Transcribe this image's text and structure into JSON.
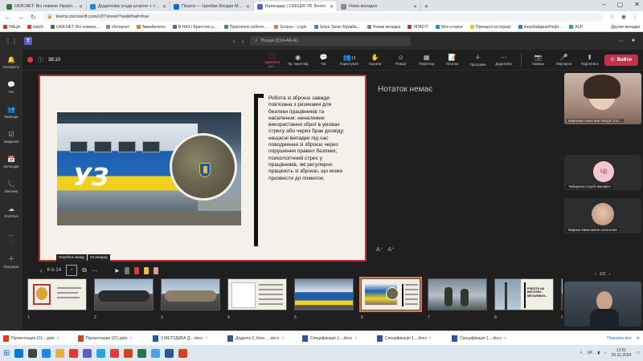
{
  "browser": {
    "tabs": [
      {
        "label": "UKR.NET: Всі новини України, о",
        "color": "#2f7d32"
      },
      {
        "label": "Додаткова угода штатне + трен",
        "color": "#1e88e5"
      },
      {
        "label": "Пошта — Цюхбах Богдан Микол",
        "color": "#0f6cbd"
      },
      {
        "label": "Календар | СЕКЦІЯ УБ Зонсп",
        "color": "#5b5fc7",
        "active": true
      },
      {
        "label": "Нова вкладка",
        "color": "#888888"
      }
    ],
    "url": "teams.microsoft.com/v2/?show#?walkthalt=true",
    "bookmarks": [
      {
        "label": "НАЦА",
        "color": "#c0392b"
      },
      {
        "label": "watch",
        "color": "#e53935"
      },
      {
        "label": "UKR.NET: Всі новини...",
        "color": "#2f7d32"
      },
      {
        "label": "Интернет",
        "color": "#888"
      },
      {
        "label": "Авиабилеты",
        "color": "#e67e22"
      },
      {
        "label": "В НАЗ | Братство р...",
        "color": "#8e44ad"
      },
      {
        "label": "Практичне роботе...",
        "color": "#16a085"
      },
      {
        "label": "Scopus - Login",
        "color": "#e67e22"
      },
      {
        "label": "Setye Загин Брумба...",
        "color": "#1e88e5"
      },
      {
        "label": "Новая вкладка",
        "color": "#888"
      },
      {
        "label": "НПАСІТ",
        "color": "#c0392b"
      },
      {
        "label": "Моя сторінг",
        "color": "#1e88e5"
      },
      {
        "label": "Прихарні інструкції",
        "color": "#f1c40f"
      },
      {
        "label": "АзербайджанНефт...",
        "color": "#2980b9"
      },
      {
        "label": "АСР",
        "color": "#27ae60"
      }
    ],
    "bookmarks_more": "Другие вкладки"
  },
  "teams": {
    "search_placeholder": "Пошук (Ctrl+Alt+E)",
    "rail": [
      {
        "label": "Активність",
        "icon": "bell-icon",
        "glyph": "🔔"
      },
      {
        "label": "Чат",
        "icon": "chat-icon",
        "glyph": "💬"
      },
      {
        "label": "Команди",
        "icon": "teams-icon",
        "glyph": "👥"
      },
      {
        "label": "Завдання",
        "icon": "tasks-icon",
        "glyph": "☑"
      },
      {
        "label": "Календар",
        "icon": "calendar-icon",
        "glyph": "📅"
      },
      {
        "label": "Виклики",
        "icon": "calls-icon",
        "glyph": "📞"
      },
      {
        "label": "OneDrive",
        "icon": "cloud-icon",
        "glyph": "☁"
      },
      {
        "label": "...",
        "icon": "more-icon",
        "glyph": "…"
      },
      {
        "label": "Програми",
        "icon": "apps-icon",
        "glyph": "＋"
      }
    ],
    "meeting": {
      "timer": "38:10",
      "tools": [
        {
          "label": "Закінчити дос...",
          "glyph": "⬚",
          "name": "stop-sharing-icon",
          "red": true
        },
        {
          "label": "Пр. перегляд",
          "glyph": "◉",
          "name": "preview-icon"
        },
        {
          "label": "Чат",
          "glyph": "💬",
          "name": "meeting-chat-icon"
        },
        {
          "label": "Користувачі",
          "glyph": "👥",
          "name": "people-icon",
          "badge": "13"
        },
        {
          "label": "Оцінити",
          "glyph": "✋",
          "name": "raise-hand-icon"
        },
        {
          "label": "Реакції",
          "glyph": "☺",
          "name": "reactions-icon"
        },
        {
          "label": "Перегляд",
          "glyph": "▦",
          "name": "view-icon"
        },
        {
          "label": "Нотатки",
          "glyph": "📝",
          "name": "notes-icon"
        },
        {
          "label": "Програми",
          "glyph": "＋",
          "name": "meeting-apps-icon"
        },
        {
          "label": "Додатково",
          "glyph": "⋯",
          "name": "more-options-icon"
        }
      ],
      "device_tools": [
        {
          "label": "Камера",
          "glyph": "📷",
          "name": "camera-icon"
        },
        {
          "label": "Мікрофон",
          "glyph": "🎤",
          "name": "microphone-icon"
        },
        {
          "label": "Поділитися",
          "glyph": "⬆",
          "name": "share-icon"
        }
      ],
      "leave_label": "Вийти"
    }
  },
  "slide": {
    "text": "Робота зі зброєю завжди пов'язана з ризиками для безпеки працівників та населення: неналежне використання зброї в умовах стресу або через брак досвіду; нещасні випадки під час поводження зі зброєю через порушення правил безпеки; психологічний стрес у працівників, які регулярно працюють зі зброєю, що може призвести до помилок.",
    "train_logo": "УЗ",
    "nav_hint": [
      "Перейти назад",
      "Ун вперед"
    ]
  },
  "slide_controls": {
    "page": "6 із 14"
  },
  "notes": {
    "empty": "Нотаток немає",
    "font_controls": [
      "A⁻",
      "A⁺"
    ]
  },
  "thumbnails": [
    {
      "num": "1",
      "style": "seal"
    },
    {
      "num": "2",
      "style": "tanks"
    },
    {
      "num": "3",
      "style": "tanks2"
    },
    {
      "num": "4",
      "style": "text"
    },
    {
      "num": "5",
      "style": "train"
    },
    {
      "num": "6",
      "style": "uz",
      "selected": true
    },
    {
      "num": "7",
      "style": "people"
    },
    {
      "num": "8",
      "style": "title",
      "title": "РОБОТА НА ВИСОКИХ МЕТАЛЕВИХ..."
    },
    {
      "num": "9",
      "style": "tanks"
    }
  ],
  "participants": {
    "p1": "Марченко Анастасія НУЦЗУ (Гос...",
    "p2_initials": "ЧІ",
    "p2": "Чеберенко Сергій Іванович",
    "p3": "Марина Миколаївна Алексєєва",
    "pager": "2/2"
  },
  "downloads": {
    "items": [
      {
        "label": "Презентация (21....pptx",
        "color": "#d04423"
      },
      {
        "label": "Презентация (21).pptx",
        "color": "#d04423"
      },
      {
        "label": "3 МЕТОДИКА Д....docx",
        "color": "#2b579a"
      },
      {
        "label": "Додаток 2_Конс.....docx",
        "color": "#2b579a"
      },
      {
        "label": "Специфікація 1....docx",
        "color": "#2b579a"
      },
      {
        "label": "Специфікація 1....docx",
        "color": "#2b579a"
      },
      {
        "label": "Специфікація 1....docx",
        "color": "#2b579a"
      }
    ],
    "show_all": "Показать все"
  },
  "taskbar": {
    "apps": [
      "#0078d4",
      "#444",
      "#1e88e5",
      "#e0b33a",
      "#e53935",
      "#5b5fc7",
      "#2ca3e0",
      "#e53935",
      "#d04423",
      "#1f7a44",
      "#4aa3df",
      "#2b579a",
      "#d04423"
    ],
    "lang": "UK",
    "time": "13:51",
    "date": "20.11.2024"
  },
  "colors": {
    "accent": "#5b5fc7",
    "leave": "#c4314b",
    "slide_border": "#bb3333",
    "thumb_selected": "#e07b39"
  }
}
